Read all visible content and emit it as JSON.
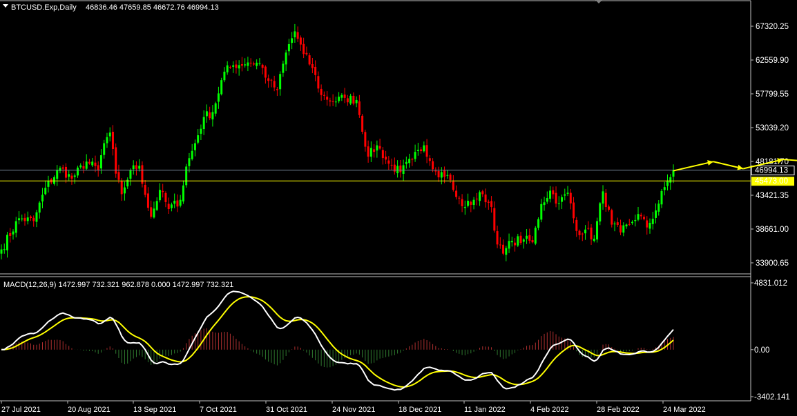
{
  "header": {
    "symbol_label": "BTCUSD.Exp,Daily",
    "ohlc_label": "46836.46 47659.85 46672.76 46994.13"
  },
  "macd": {
    "label": "MACD(12,26,9) 1472.997 732.321 962.878 0.000 1472.997 732.321",
    "ytick_labels": [
      "4831.012",
      "0.00",
      "-3402.141"
    ]
  },
  "colors": {
    "background": "#000000",
    "bull_candle": "#00ff00",
    "bear_candle": "#ff0000",
    "grid_border": "#c0c0c0",
    "price_line": "#7a8a9a",
    "level_line": "#ffff00",
    "macd_line": "#ffffff",
    "signal_line": "#ffff00",
    "arrow": "#ffff00"
  },
  "chart_data": {
    "type": "candlestick",
    "price_axis": {
      "tick_labels": [
        "67320.25",
        "62559.90",
        "57799.55",
        "53039.20",
        "48181.70",
        "43421.35",
        "38661.00",
        "33900.65"
      ],
      "range": [
        31000,
        70000
      ]
    },
    "current_price_label": "46994.13",
    "level_label": "45473.00",
    "current_price": 46994.13,
    "level_price": 45473.0,
    "x_labels": [
      "27 Jul 2021",
      "20 Aug 2021",
      "13 Sep 2021",
      "7 Oct 2021",
      "31 Oct 2021",
      "24 Nov 2021",
      "18 Dec 2021",
      "11 Jan 2022",
      "4 Feb 2022",
      "28 Feb 2022",
      "24 Mar 2022"
    ],
    "close_anchors": [
      [
        0,
        35800
      ],
      [
        6,
        40200
      ],
      [
        11,
        39800
      ],
      [
        15,
        44500
      ],
      [
        20,
        47300
      ],
      [
        24,
        45800
      ],
      [
        29,
        48200
      ],
      [
        33,
        47000
      ],
      [
        35,
        50800
      ],
      [
        37,
        52300
      ],
      [
        39,
        46500
      ],
      [
        41,
        43600
      ],
      [
        44,
        47000
      ],
      [
        47,
        47600
      ],
      [
        49,
        43500
      ],
      [
        51,
        40400
      ],
      [
        54,
        44200
      ],
      [
        57,
        41500
      ],
      [
        61,
        42800
      ],
      [
        63,
        47500
      ],
      [
        66,
        50800
      ],
      [
        69,
        54500
      ],
      [
        72,
        55200
      ],
      [
        76,
        60900
      ],
      [
        79,
        61800
      ],
      [
        84,
        62200
      ],
      [
        88,
        62100
      ],
      [
        91,
        59600
      ],
      [
        94,
        58300
      ],
      [
        97,
        63600
      ],
      [
        100,
        66600
      ],
      [
        103,
        63400
      ],
      [
        106,
        61400
      ],
      [
        109,
        57600
      ],
      [
        113,
        56700
      ],
      [
        117,
        57200
      ],
      [
        121,
        56900
      ],
      [
        125,
        48900
      ],
      [
        128,
        50500
      ],
      [
        132,
        47900
      ],
      [
        136,
        46700
      ],
      [
        140,
        48500
      ],
      [
        144,
        50500
      ],
      [
        148,
        46800
      ],
      [
        152,
        46300
      ],
      [
        155,
        43200
      ],
      [
        158,
        41800
      ],
      [
        161,
        42800
      ],
      [
        164,
        43600
      ],
      [
        167,
        41800
      ],
      [
        169,
        36500
      ],
      [
        171,
        35200
      ],
      [
        174,
        37000
      ],
      [
        178,
        37200
      ],
      [
        181,
        36800
      ],
      [
        184,
        42200
      ],
      [
        187,
        44100
      ],
      [
        190,
        42300
      ],
      [
        193,
        43800
      ],
      [
        196,
        38400
      ],
      [
        199,
        38600
      ],
      [
        202,
        37300
      ],
      [
        205,
        44000
      ],
      [
        208,
        39300
      ],
      [
        211,
        38200
      ],
      [
        214,
        39300
      ],
      [
        217,
        40800
      ],
      [
        220,
        38900
      ],
      [
        223,
        41300
      ],
      [
        226,
        44600
      ],
      [
        229,
        46994
      ]
    ],
    "macd_range": [
      -3402.141,
      4831.012
    ],
    "projection_arrow": [
      [
        0,
        46900
      ],
      [
        4,
        48200
      ],
      [
        7,
        47200
      ],
      [
        11,
        48500
      ],
      [
        15,
        48100
      ],
      [
        19,
        51500
      ]
    ]
  }
}
